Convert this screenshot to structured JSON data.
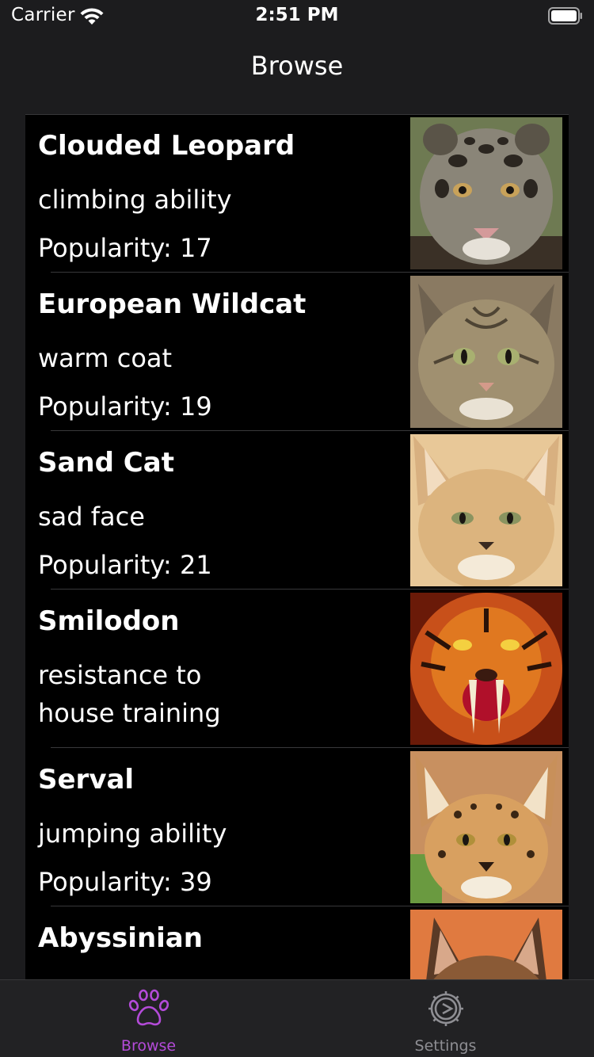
{
  "status_bar": {
    "carrier": "Carrier",
    "time": "2:51 PM"
  },
  "nav": {
    "title": "Browse"
  },
  "cats": [
    {
      "name": "Clouded Leopard",
      "feature": "climbing ability",
      "popularity": "Popularity: 17",
      "image": "clouded-leopard-photo"
    },
    {
      "name": "European Wildcat",
      "feature": "warm coat",
      "popularity": "Popularity: 19",
      "image": "european-wildcat-photo"
    },
    {
      "name": "Sand Cat",
      "feature": "sad face",
      "popularity": "Popularity: 21",
      "image": "sand-cat-photo"
    },
    {
      "name": "Smilodon",
      "feature": "resistance to house training",
      "popularity": "",
      "image": "smilodon-photo"
    },
    {
      "name": "Serval",
      "feature": "jumping ability",
      "popularity": "Popularity: 39",
      "image": "serval-photo"
    },
    {
      "name": "Abyssinian",
      "feature": "",
      "popularity": "",
      "image": "abyssinian-photo"
    }
  ],
  "tab_bar": {
    "browse_label": "Browse",
    "settings_label": "Settings",
    "active_color": "#b44bd9",
    "inactive_color": "#8e8e93"
  }
}
